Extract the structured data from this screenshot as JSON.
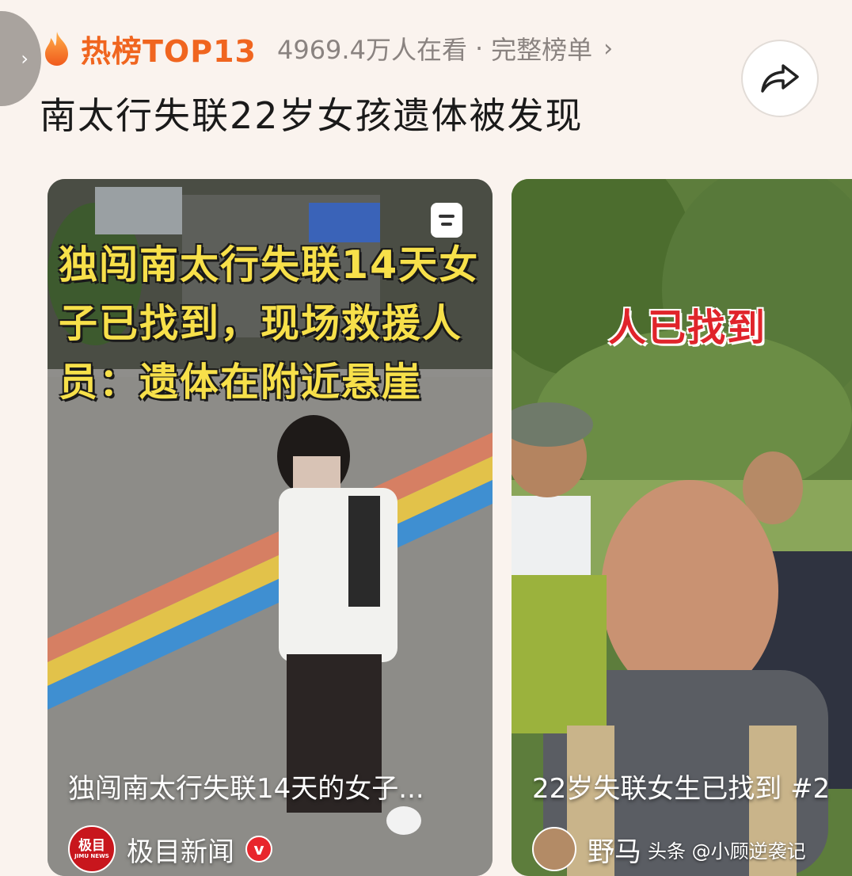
{
  "header": {
    "hot_label": "热榜TOP13",
    "viewers": "4969.4万人在看",
    "separator": "·",
    "full_list": "完整榜单",
    "full_list_arrow": "›",
    "headline": "南太行失联22岁女孩遗体被发现"
  },
  "icons": {
    "side_tab": "chevron-right-icon",
    "flame": "flame-icon",
    "share": "share-arrow-icon",
    "bookmark": "bookmark-icon",
    "verified": "verified-v-icon"
  },
  "side_tab": {
    "glyph": "›"
  },
  "cards": [
    {
      "overlay_lines": [
        "独闯南太行失联14天女",
        "子已找到，现场救援人",
        "员：遗体在附近悬崖"
      ],
      "title": "独闯南太行失联14天的女子...",
      "source_logo": "极目",
      "source_logo_sub": "JIMU NEWS",
      "source_name": "极目新闻",
      "badge": "v"
    },
    {
      "overlay": "人已找到",
      "title": "22岁失联女生已找到 #2",
      "source_name": "野马",
      "watermark": "头条 @小顾逆袭记"
    }
  ],
  "colors": {
    "accent_orange": "#f0651f",
    "overlay_yellow": "#f7e04a",
    "overlay_red": "#e0242b",
    "background": "#faf3ee"
  }
}
